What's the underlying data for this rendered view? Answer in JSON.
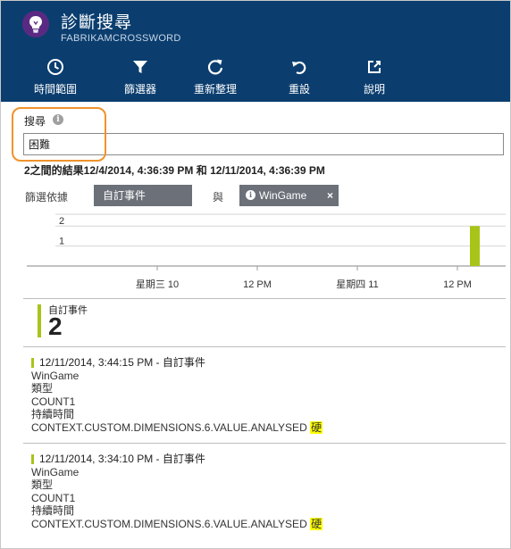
{
  "header": {
    "title": "診斷搜尋",
    "subtitle": "FABRIKAMCROSSWORD",
    "toolbar": [
      {
        "name": "time-range",
        "icon": "clock-icon",
        "label": "時間範圍"
      },
      {
        "name": "filter",
        "icon": "filter-icon",
        "label": "篩選器"
      },
      {
        "name": "refresh",
        "icon": "refresh-icon",
        "label": "重新整理"
      },
      {
        "name": "reset",
        "icon": "undo-icon",
        "label": "重設"
      },
      {
        "name": "help",
        "icon": "external-link-icon",
        "label": "說明"
      }
    ],
    "colors": {
      "header_bg": "#0b3e6f",
      "app_icon_bg": "#5a2a82"
    }
  },
  "search": {
    "label": "搜尋",
    "value": "困難"
  },
  "results": {
    "summary": "2之間的結果12/4/2014, 4:36:39 PM 和 12/11/2014, 4:36:39 PM"
  },
  "filters": {
    "label": "篩選依據",
    "chips": [
      {
        "label": "自訂事件"
      },
      {
        "label": "WinGame",
        "close": "×"
      }
    ],
    "and_label": "與",
    "chip_color": "#6b7079"
  },
  "chart_data": {
    "type": "bar",
    "y_ticks": [
      "2",
      "1"
    ],
    "x_tick_labels": [
      "星期三 10",
      "12 PM",
      "星期四 11",
      "12 PM"
    ],
    "ylim": [
      0,
      2.5
    ],
    "series": [
      {
        "color": "#a8c418",
        "points": [
          {
            "x": "Thu 11, ~2 PM",
            "y": 2
          }
        ]
      }
    ]
  },
  "event_count": {
    "label": "自訂事件",
    "value": "2",
    "accent": "#a8c418"
  },
  "items": [
    {
      "header": "12/11/2014, 3:44:15 PM - 自訂事件",
      "lines": [
        "WinGame",
        "類型",
        "COUNT1",
        "持續時間"
      ],
      "context_prefix": "CONTEXT.CUSTOM.DIMENSIONS.6.VALUE.ANALYSED",
      "highlight": "硬"
    },
    {
      "header": "12/11/2014, 3:34:10 PM - 自訂事件",
      "lines": [
        "WinGame",
        "類型",
        "COUNT1",
        "持續時間"
      ],
      "context_prefix": "CONTEXT.CUSTOM.DIMENSIONS.6.VALUE.ANALYSED",
      "highlight": "硬"
    }
  ]
}
